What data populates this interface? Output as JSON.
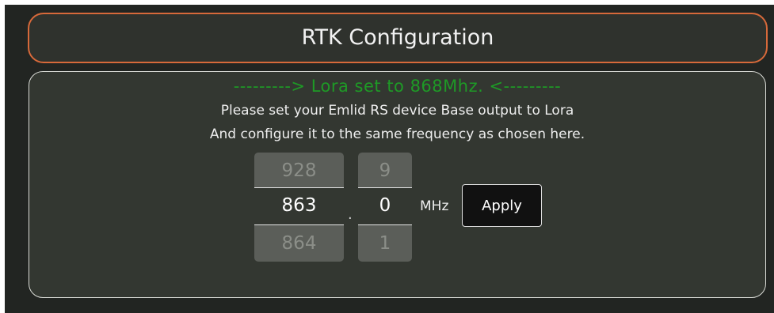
{
  "title": "RTK Configuration",
  "status_message": "---------> Lora set to 868Mhz. <---------",
  "instructions": {
    "line1": "Please set your Emlid RS device Base output to Lora",
    "line2": "And configure it to the same frequency as chosen here."
  },
  "frequency_picker": {
    "mhz": {
      "previous": "928",
      "current": "863",
      "next": "864"
    },
    "separator": ".",
    "decimal": {
      "previous": "9",
      "current": "0",
      "next": "1"
    },
    "unit": "MHz"
  },
  "apply_label": "Apply",
  "colors": {
    "background": "#222522",
    "panel": "#333731",
    "title_border": "#d7693a",
    "status_text": "#1e9a26",
    "tumbler": "#5b5e59",
    "button": "#111111"
  }
}
